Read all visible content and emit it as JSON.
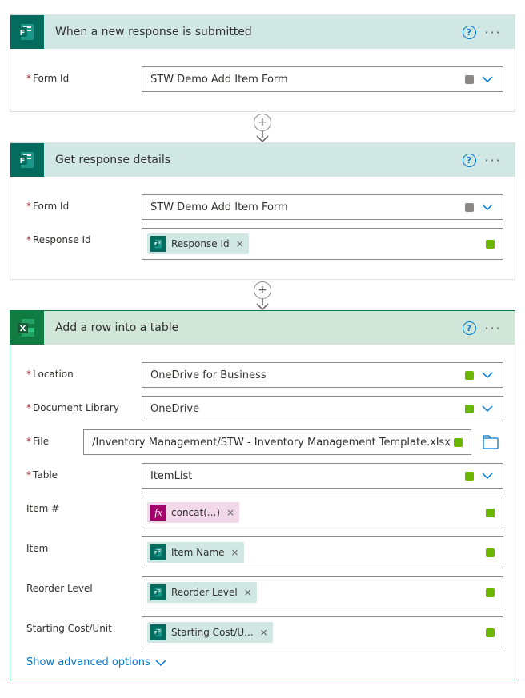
{
  "cards": {
    "trigger": {
      "title": "When a new response is submitted",
      "field1_label": "Form Id",
      "field1_value": "STW Demo Add Item Form"
    },
    "getResp": {
      "title": "Get response details",
      "field1_label": "Form Id",
      "field1_value": "STW Demo Add Item Form",
      "field2_label": "Response Id",
      "field2_token": "Response Id"
    },
    "addRow": {
      "title": "Add a row into a table",
      "loc_label": "Location",
      "loc_value": "OneDrive for Business",
      "docLib_label": "Document Library",
      "docLib_value": "OneDrive",
      "file_label": "File",
      "file_value": "/Inventory Management/STW - Inventory Management Template.xlsx",
      "table_label": "Table",
      "table_value": "ItemList",
      "itemNum_label": "Item #",
      "itemNum_token": "concat(...)",
      "item_label": "Item",
      "item_token": "Item Name",
      "reorder_label": "Reorder Level",
      "reorder_token": "Reorder Level",
      "cost_label": "Starting Cost/Unit",
      "cost_token": "Starting Cost/U...",
      "advanced": "Show advanced options"
    }
  }
}
